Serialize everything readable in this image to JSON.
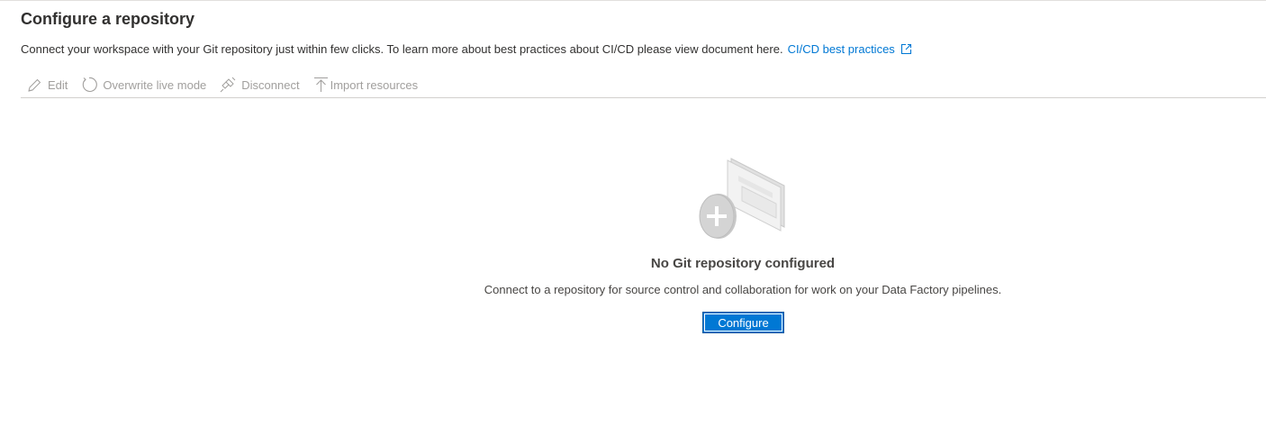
{
  "header": {
    "title": "Configure a repository",
    "description": "Connect your workspace with your Git repository just within few clicks. To learn more about best practices about CI/CD please view document here.",
    "link_label": "CI/CD best practices"
  },
  "toolbar": {
    "edit_label": "Edit",
    "overwrite_label": "Overwrite live mode",
    "disconnect_label": "Disconnect",
    "import_label": "Import resources"
  },
  "empty_state": {
    "title": "No Git repository configured",
    "description": "Connect to a repository for source control and collaboration for work on your Data Factory pipelines.",
    "button_label": "Configure"
  },
  "colors": {
    "accent": "#0078d4",
    "disabled_text": "#a19f9d"
  }
}
